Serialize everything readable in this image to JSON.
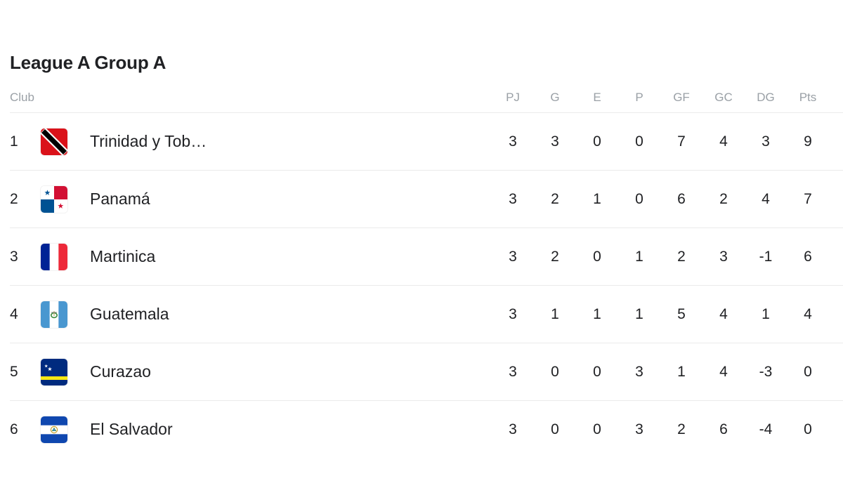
{
  "header": {
    "title": "League A Group A"
  },
  "table": {
    "columns": [
      {
        "key": "club",
        "label": "Club"
      },
      {
        "key": "pj",
        "label": "PJ"
      },
      {
        "key": "g",
        "label": "G"
      },
      {
        "key": "e",
        "label": "E"
      },
      {
        "key": "p",
        "label": "P"
      },
      {
        "key": "gf",
        "label": "GF"
      },
      {
        "key": "gc",
        "label": "GC"
      },
      {
        "key": "dg",
        "label": "DG"
      },
      {
        "key": "pts",
        "label": "Pts"
      }
    ],
    "rows": [
      {
        "rank": "1",
        "team": "Trinidad y Tob…",
        "flag": "trinidad-and-tobago-flag",
        "pj": "3",
        "g": "3",
        "e": "0",
        "p": "0",
        "gf": "7",
        "gc": "4",
        "dg": "3",
        "pts": "9"
      },
      {
        "rank": "2",
        "team": "Panamá",
        "flag": "panama-flag",
        "pj": "3",
        "g": "2",
        "e": "1",
        "p": "0",
        "gf": "6",
        "gc": "2",
        "dg": "4",
        "pts": "7"
      },
      {
        "rank": "3",
        "team": "Martinica",
        "flag": "martinique-flag",
        "pj": "3",
        "g": "2",
        "e": "0",
        "p": "1",
        "gf": "2",
        "gc": "3",
        "dg": "-1",
        "pts": "6"
      },
      {
        "rank": "4",
        "team": "Guatemala",
        "flag": "guatemala-flag",
        "pj": "3",
        "g": "1",
        "e": "1",
        "p": "1",
        "gf": "5",
        "gc": "4",
        "dg": "1",
        "pts": "4"
      },
      {
        "rank": "5",
        "team": "Curazao",
        "flag": "curacao-flag",
        "pj": "3",
        "g": "0",
        "e": "0",
        "p": "3",
        "gf": "1",
        "gc": "4",
        "dg": "-3",
        "pts": "0"
      },
      {
        "rank": "6",
        "team": "El Salvador",
        "flag": "el-salvador-flag",
        "pj": "3",
        "g": "0",
        "e": "0",
        "p": "3",
        "gf": "2",
        "gc": "6",
        "dg": "-4",
        "pts": "0"
      }
    ]
  },
  "colors": {
    "text": "#202124",
    "muted": "#9aa0a6",
    "divider": "#ebebeb",
    "background": "#ffffff"
  }
}
